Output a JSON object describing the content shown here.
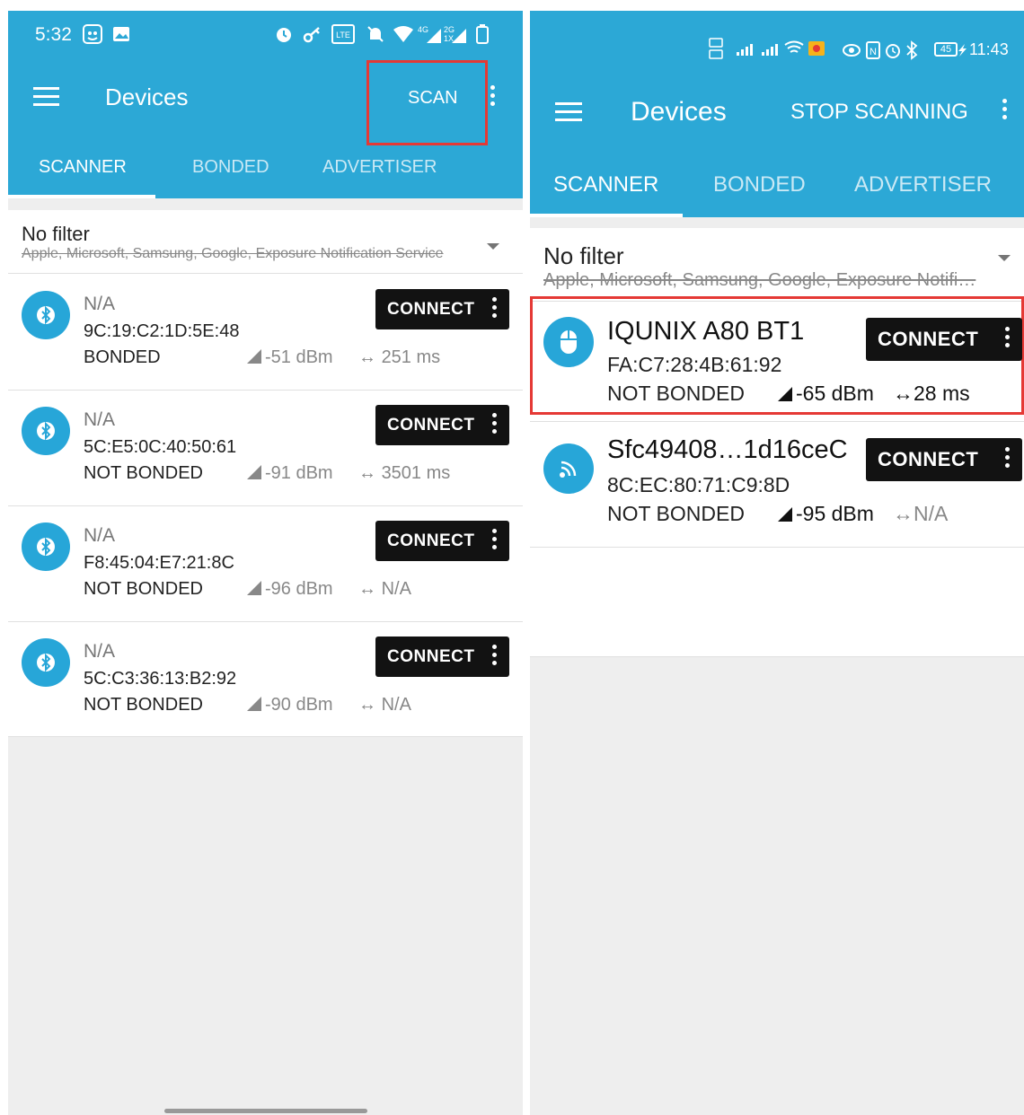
{
  "left": {
    "status": {
      "time": "5:32"
    },
    "title": "Devices",
    "action": "SCAN",
    "tabs": [
      "SCANNER",
      "BONDED",
      "ADVERTISER"
    ],
    "filter": {
      "title": "No filter",
      "subtitle": "Apple, Microsoft, Samsung, Google, Exposure Notification Service"
    },
    "devices": [
      {
        "name": "N/A",
        "mac": "9C:19:C2:1D:5E:48",
        "bond": "BONDED",
        "rssi": "-51 dBm",
        "interval": "251 ms",
        "button": "CONNECT",
        "icon": "bluetooth-icon"
      },
      {
        "name": "N/A",
        "mac": "5C:E5:0C:40:50:61",
        "bond": "NOT BONDED",
        "rssi": "-91 dBm",
        "interval": "3501 ms",
        "button": "CONNECT",
        "icon": "bluetooth-icon"
      },
      {
        "name": "N/A",
        "mac": "F8:45:04:E7:21:8C",
        "bond": "NOT BONDED",
        "rssi": "-96 dBm",
        "interval": "N/A",
        "button": "CONNECT",
        "icon": "bluetooth-icon"
      },
      {
        "name": "N/A",
        "mac": "5C:C3:36:13:B2:92",
        "bond": "NOT BONDED",
        "rssi": "-90 dBm",
        "interval": "N/A",
        "button": "CONNECT",
        "icon": "bluetooth-icon"
      }
    ]
  },
  "right": {
    "status": {
      "time": "11:43",
      "battery": "45"
    },
    "title": "Devices",
    "action": "STOP SCANNING",
    "tabs": [
      "SCANNER",
      "BONDED",
      "ADVERTISER"
    ],
    "filter": {
      "title": "No filter",
      "subtitle": "Apple, Microsoft, Samsung, Google, Exposure Notifi…"
    },
    "devices": [
      {
        "name": "IQUNIX A80 BT1",
        "mac": "FA:C7:28:4B:61:92",
        "bond": "NOT BONDED",
        "rssi": "-65 dBm",
        "interval": "28 ms",
        "button": "CONNECT",
        "icon": "mouse-icon"
      },
      {
        "name": "Sfc49408…1d16ceC",
        "mac": "8C:EC:80:71:C9:8D",
        "bond": "NOT BONDED",
        "rssi": "-95 dBm",
        "interval": "N/A",
        "button": "CONNECT",
        "icon": "wireless-icon"
      }
    ]
  },
  "colors": {
    "primary": "#2ca8d6",
    "highlight": "#e53935",
    "button": "#121212"
  }
}
